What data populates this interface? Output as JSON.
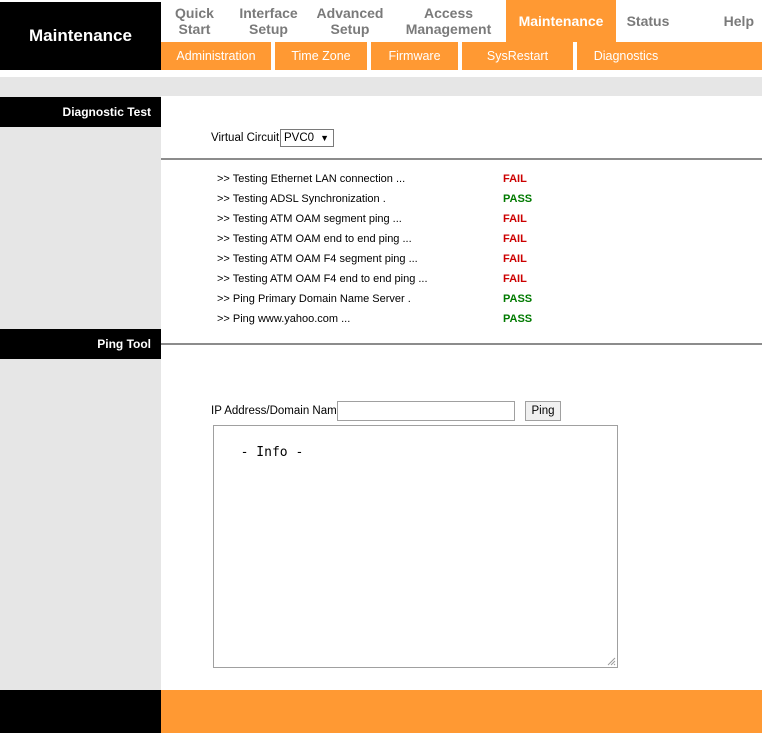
{
  "brand": {
    "title": "Maintenance"
  },
  "main_nav": [
    {
      "label_line1": "Quick",
      "label_line2": "Start",
      "active": false
    },
    {
      "label_line1": "Interface",
      "label_line2": "Setup",
      "active": false
    },
    {
      "label_line1": "Advanced",
      "label_line2": "Setup",
      "active": false
    },
    {
      "label_line1": "Access",
      "label_line2": "Management",
      "active": false
    },
    {
      "label_line1": "Maintenance",
      "label_line2": "",
      "active": true
    },
    {
      "label_line1": "Status",
      "label_line2": "",
      "active": false
    },
    {
      "label_line1": "Help",
      "label_line2": "",
      "active": false
    }
  ],
  "sub_nav": [
    {
      "label": "Administration"
    },
    {
      "label": "Time Zone"
    },
    {
      "label": "Firmware"
    },
    {
      "label": "SysRestart"
    },
    {
      "label": "Diagnostics"
    }
  ],
  "diagnostic": {
    "section_label": "Diagnostic Test",
    "virtual_circuit_label": "Virtual Circuit:",
    "virtual_circuit_value": "PVC0",
    "select_arrow": "▼",
    "tests": [
      {
        "name": ">> Testing Ethernet LAN connection ...",
        "status": "FAIL"
      },
      {
        "name": ">> Testing ADSL Synchronization .",
        "status": "PASS"
      },
      {
        "name": ">> Testing ATM OAM segment ping ...",
        "status": "FAIL"
      },
      {
        "name": ">> Testing ATM OAM end to end ping ...",
        "status": "FAIL"
      },
      {
        "name": ">> Testing ATM OAM F4 segment ping ...",
        "status": "FAIL"
      },
      {
        "name": ">> Testing ATM OAM F4 end to end ping ...",
        "status": "FAIL"
      },
      {
        "name": ">> Ping Primary Domain Name Server .",
        "status": "PASS"
      },
      {
        "name": ">> Ping www.yahoo.com ...",
        "status": "PASS"
      }
    ]
  },
  "ping_tool": {
    "section_label": "Ping Tool",
    "ip_label": "IP Address/Domain Name:",
    "ip_value": "",
    "ping_button_label": "Ping",
    "info_text": "- Info -"
  },
  "colors": {
    "accent_orange": "#ff9933",
    "header_black": "#000000",
    "panel_gray": "#e6e6e6",
    "fail_red": "#cc0000",
    "pass_green": "#007a00"
  }
}
